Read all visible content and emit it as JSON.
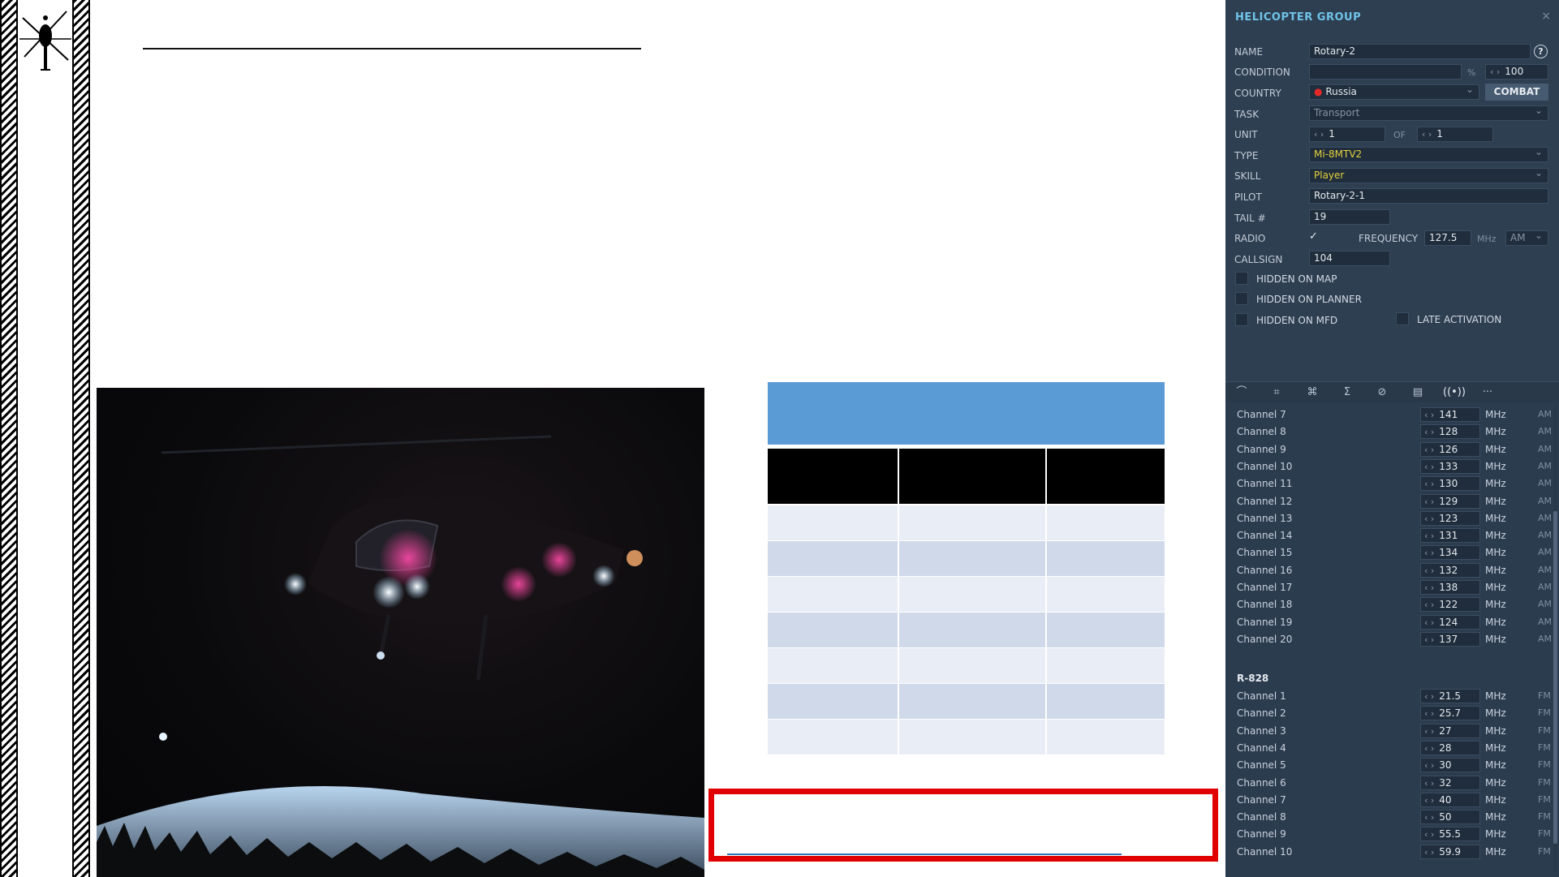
{
  "panel": {
    "title": "HELICOPTER GROUP",
    "close": "×",
    "help": "?",
    "name_label": "NAME",
    "name_value": "Rotary-2",
    "condition_label": "CONDITION",
    "condition_unit": "%",
    "condition_value": "100",
    "country_label": "COUNTRY",
    "country_value": "Russia",
    "combat_label": "COMBAT",
    "task_label": "TASK",
    "task_value": "Transport",
    "unit_label": "UNIT",
    "unit_value": "1",
    "unit_of": "OF",
    "unit_total": "1",
    "type_label": "TYPE",
    "type_value": "Mi-8MTV2",
    "skill_label": "SKILL",
    "skill_value": "Player",
    "pilot_label": "PILOT",
    "pilot_value": "Rotary-2-1",
    "tail_label": "TAIL #",
    "tail_value": "19",
    "radio_label": "RADIO",
    "radio_checked": "✓",
    "frequency_label": "FREQUENCY",
    "frequency_value": "127.5",
    "frequency_unit": "MHz",
    "modulation": "AM",
    "callsign_label": "CALLSIGN",
    "callsign_value": "104",
    "hidden_map": "HIDDEN ON MAP",
    "hidden_planner": "HIDDEN ON PLANNER",
    "hidden_mfd": "HIDDEN ON MFD",
    "late_activation": "LATE ACTIVATION"
  },
  "icons": [
    "route-icon",
    "triggers-icon",
    "payload-icon",
    "summary-icon",
    "failures-icon",
    "loadout-icon",
    "radio-icon",
    "more-icon"
  ],
  "channels_r863": [
    {
      "name": "Channel 7",
      "value": "141",
      "unit": "MHz",
      "mod": "AM"
    },
    {
      "name": "Channel 8",
      "value": "128",
      "unit": "MHz",
      "mod": "AM"
    },
    {
      "name": "Channel 9",
      "value": "126",
      "unit": "MHz",
      "mod": "AM"
    },
    {
      "name": "Channel 10",
      "value": "133",
      "unit": "MHz",
      "mod": "AM"
    },
    {
      "name": "Channel 11",
      "value": "130",
      "unit": "MHz",
      "mod": "AM"
    },
    {
      "name": "Channel 12",
      "value": "129",
      "unit": "MHz",
      "mod": "AM"
    },
    {
      "name": "Channel 13",
      "value": "123",
      "unit": "MHz",
      "mod": "AM"
    },
    {
      "name": "Channel 14",
      "value": "131",
      "unit": "MHz",
      "mod": "AM"
    },
    {
      "name": "Channel 15",
      "value": "134",
      "unit": "MHz",
      "mod": "AM"
    },
    {
      "name": "Channel 16",
      "value": "132",
      "unit": "MHz",
      "mod": "AM"
    },
    {
      "name": "Channel 17",
      "value": "138",
      "unit": "MHz",
      "mod": "AM"
    },
    {
      "name": "Channel 18",
      "value": "122",
      "unit": "MHz",
      "mod": "AM"
    },
    {
      "name": "Channel 19",
      "value": "124",
      "unit": "MHz",
      "mod": "AM"
    },
    {
      "name": "Channel 20",
      "value": "137",
      "unit": "MHz",
      "mod": "AM"
    }
  ],
  "r828_label": "R-828",
  "channels_r828": [
    {
      "name": "Channel 1",
      "value": "21.5",
      "unit": "MHz",
      "mod": "FM"
    },
    {
      "name": "Channel 2",
      "value": "25.7",
      "unit": "MHz",
      "mod": "FM"
    },
    {
      "name": "Channel 3",
      "value": "27",
      "unit": "MHz",
      "mod": "FM"
    },
    {
      "name": "Channel 4",
      "value": "28",
      "unit": "MHz",
      "mod": "FM"
    },
    {
      "name": "Channel 5",
      "value": "30",
      "unit": "MHz",
      "mod": "FM"
    },
    {
      "name": "Channel 6",
      "value": "32",
      "unit": "MHz",
      "mod": "FM"
    },
    {
      "name": "Channel 7",
      "value": "40",
      "unit": "MHz",
      "mod": "FM"
    },
    {
      "name": "Channel 8",
      "value": "50",
      "unit": "MHz",
      "mod": "FM"
    },
    {
      "name": "Channel 9",
      "value": "55.5",
      "unit": "MHz",
      "mod": "FM"
    },
    {
      "name": "Channel 10",
      "value": "59.9",
      "unit": "MHz",
      "mod": "FM"
    }
  ],
  "colors": {
    "panel_bg": "#2e3f52",
    "title": "#6fc4e8",
    "table_header": "#5b9bd5",
    "red_box": "#e00000",
    "country_dot": "#e02a2a"
  }
}
